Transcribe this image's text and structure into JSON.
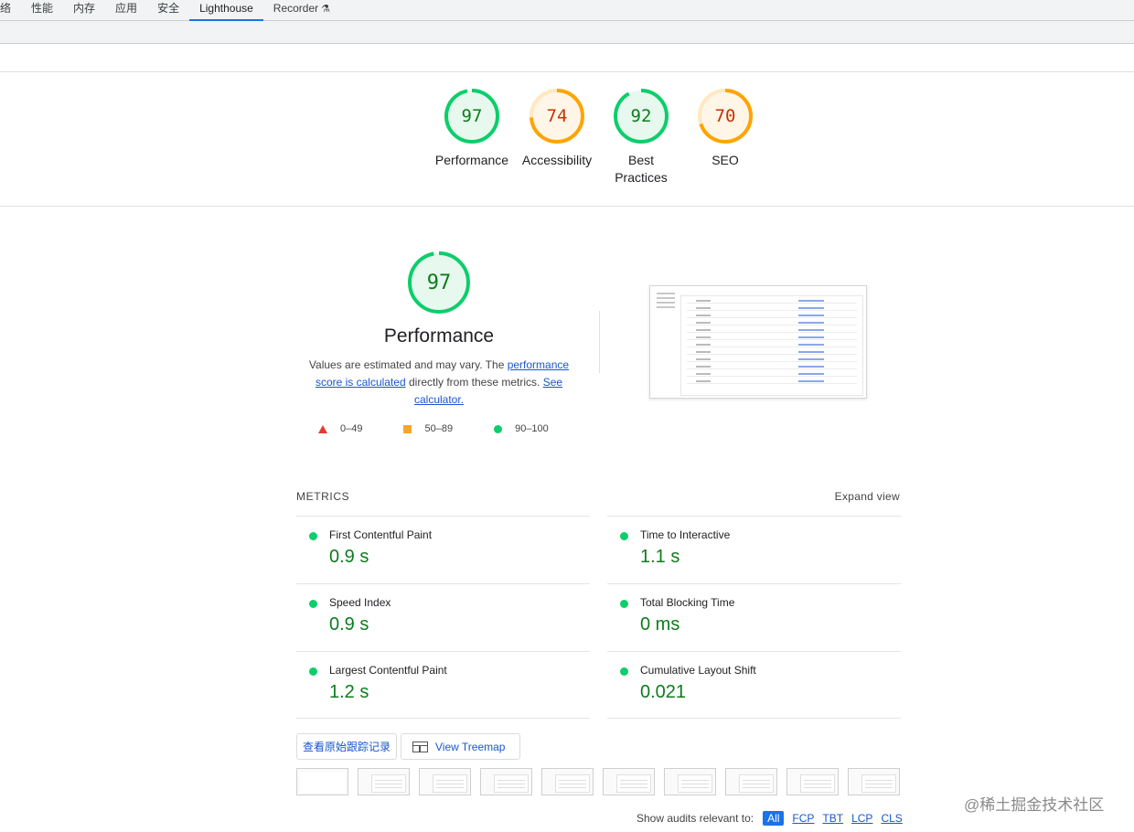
{
  "devtools": {
    "tabs": [
      {
        "label": "络"
      },
      {
        "label": "性能"
      },
      {
        "label": "内存"
      },
      {
        "label": "应用"
      },
      {
        "label": "安全"
      },
      {
        "label": "Lighthouse",
        "active": true
      },
      {
        "label": "Recorder"
      }
    ]
  },
  "categories": [
    {
      "label": "Performance",
      "score": 97,
      "color": "#0cce6b"
    },
    {
      "label": "Accessibility",
      "score": 74,
      "color": "#ffa400"
    },
    {
      "label": "Best",
      "label2": "Practices",
      "score": 92,
      "color": "#0cce6b"
    },
    {
      "label": "SEO",
      "score": 70,
      "color": "#ffa400"
    }
  ],
  "performance": {
    "score": 97,
    "title": "Performance",
    "desc_1": "Values are estimated and may vary. The ",
    "link_1": "performance score is calculated",
    "desc_2": " directly from these metrics. ",
    "link_2": "See calculator.",
    "legend": [
      "0–49",
      "50–89",
      "90–100"
    ]
  },
  "metrics": {
    "header": "METRICS",
    "expand": "Expand view",
    "items": [
      {
        "name": "First Contentful Paint",
        "value": "0.9 s"
      },
      {
        "name": "Time to Interactive",
        "value": "1.1 s"
      },
      {
        "name": "Speed Index",
        "value": "0.9 s"
      },
      {
        "name": "Total Blocking Time",
        "value": "0 ms"
      },
      {
        "name": "Largest Contentful Paint",
        "value": "1.2 s"
      },
      {
        "name": "Cumulative Layout Shift",
        "value": "0.021"
      }
    ]
  },
  "buttons": {
    "trace": "查看原始跟踪记录",
    "treemap": "View Treemap"
  },
  "filter": {
    "label": "Show audits relevant to:",
    "chips": [
      "All",
      "FCP",
      "TBT",
      "LCP",
      "CLS"
    ]
  },
  "watermark": "@稀土掘金技术社区"
}
